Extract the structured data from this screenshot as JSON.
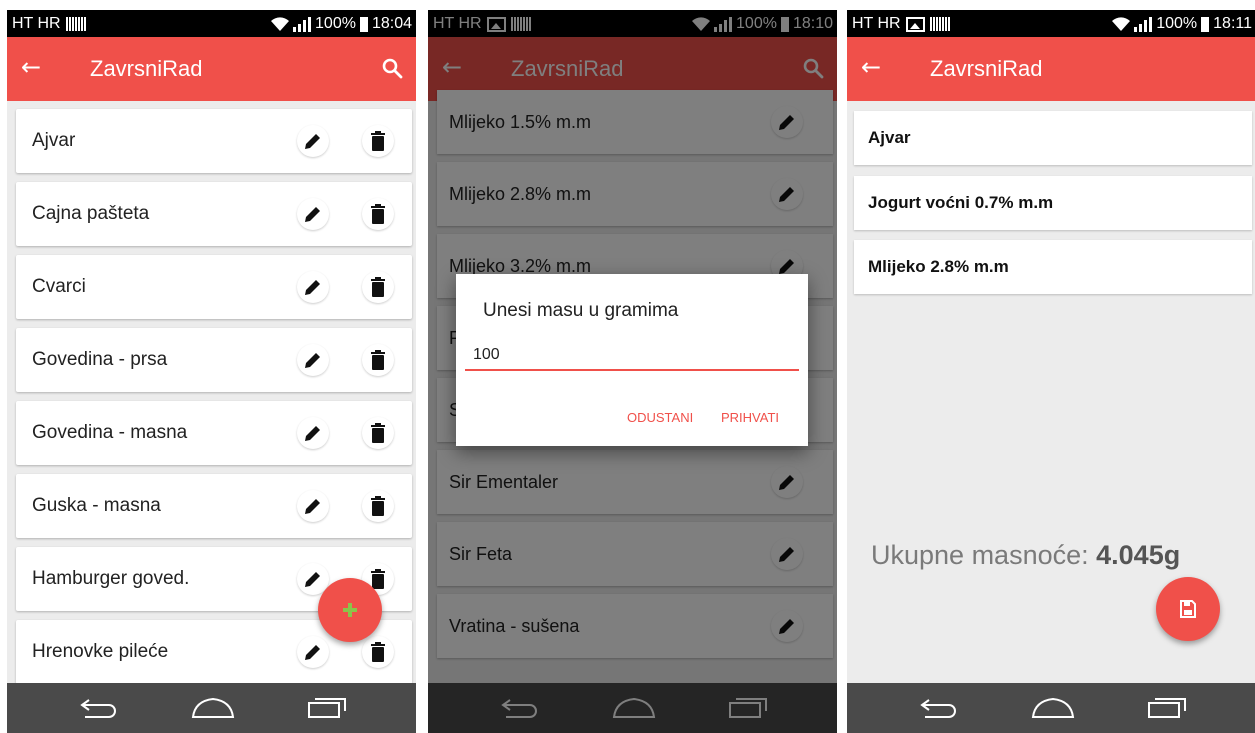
{
  "status_bars": [
    {
      "carrier": "HT HR",
      "battery": "100%",
      "time": "18:04"
    },
    {
      "carrier": "HT HR",
      "battery": "100%",
      "time": "18:10"
    },
    {
      "carrier": "HT HR",
      "battery": "100%",
      "time": "18:11"
    }
  ],
  "app": {
    "title": "ZavrsniRad",
    "back_icon": "arrow-left-icon",
    "search_icon": "search-icon"
  },
  "screen1": {
    "items": [
      {
        "label": "Ajvar"
      },
      {
        "label": "Cajna pašteta"
      },
      {
        "label": "Cvarci"
      },
      {
        "label": "Govedina - prsa"
      },
      {
        "label": "Govedina - masna"
      },
      {
        "label": "Guska - masna"
      },
      {
        "label": "Hamburger goved."
      },
      {
        "label": "Hrenovke pileće"
      }
    ],
    "fab_icon": "plus-icon"
  },
  "screen2": {
    "items": [
      {
        "label": "Mlijeko 1.5% m.m"
      },
      {
        "label": "Mlijeko 2.8% m.m"
      },
      {
        "label": "Mlijeko 3.2% m.m"
      },
      {
        "label": "P"
      },
      {
        "label": "S"
      },
      {
        "label": "Sir Ementaler"
      },
      {
        "label": "Sir Feta"
      },
      {
        "label": "Vratina - sušena"
      }
    ],
    "dialog": {
      "title": "Unesi masu u gramima",
      "value": "100",
      "cancel_label": "ODUSTANI",
      "accept_label": "PRIHVATI"
    }
  },
  "screen3": {
    "items": [
      {
        "label": "Ajvar"
      },
      {
        "label": "Jogurt voćni 0.7% m.m"
      },
      {
        "label": "Mlijeko 2.8% m.m"
      }
    ],
    "total_label": "Ukupne masnoće:",
    "total_value": "4.045g",
    "fab_icon": "save-icon"
  },
  "colors": {
    "accent": "#f0504a",
    "navbar": "#4a4a4a",
    "background": "#ececec"
  }
}
